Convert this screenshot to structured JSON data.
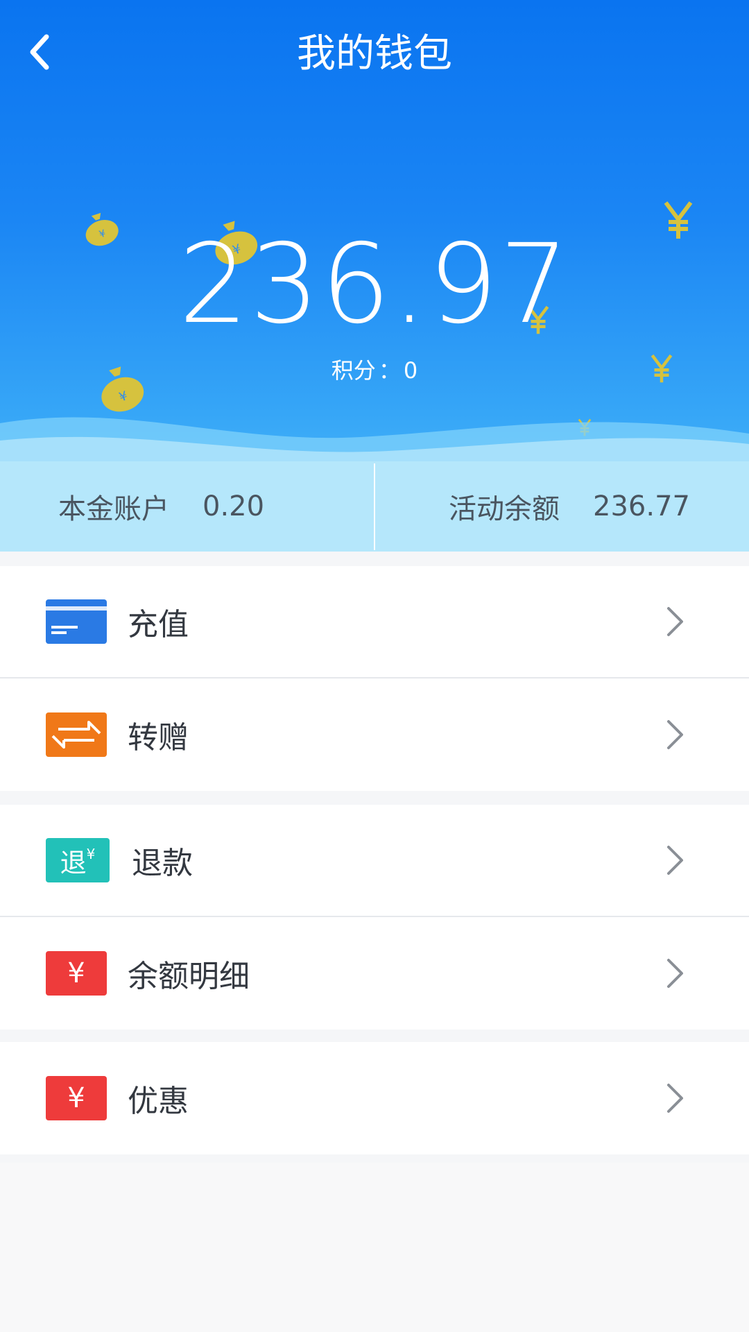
{
  "header": {
    "title": "我的钱包"
  },
  "wallet": {
    "balance": "236.97",
    "points_label": "积分",
    "points_sep": "：",
    "points_value": "0"
  },
  "accounts": {
    "principal_label": "本金账户",
    "principal_value": "0.20",
    "activity_label": "活动余额",
    "activity_value": "236.77"
  },
  "menu": [
    {
      "label": "充值",
      "icon": "card-icon",
      "color": "#2a7ae4"
    },
    {
      "label": "转赠",
      "icon": "transfer-arrows-icon",
      "color": "#f07818"
    },
    {
      "label": "退款",
      "icon": "refund-icon",
      "color": "#22c1b8",
      "icon_text": "退",
      "icon_sup": "¥"
    },
    {
      "label": "余额明细",
      "icon": "yen-icon",
      "color": "#ee3b3b",
      "icon_text": "¥"
    },
    {
      "label": "优惠",
      "icon": "yen-icon",
      "color": "#ee3b3b",
      "icon_text": "¥"
    }
  ],
  "colors": {
    "primary": "#0a74f0",
    "gold": "#d6c23e"
  }
}
